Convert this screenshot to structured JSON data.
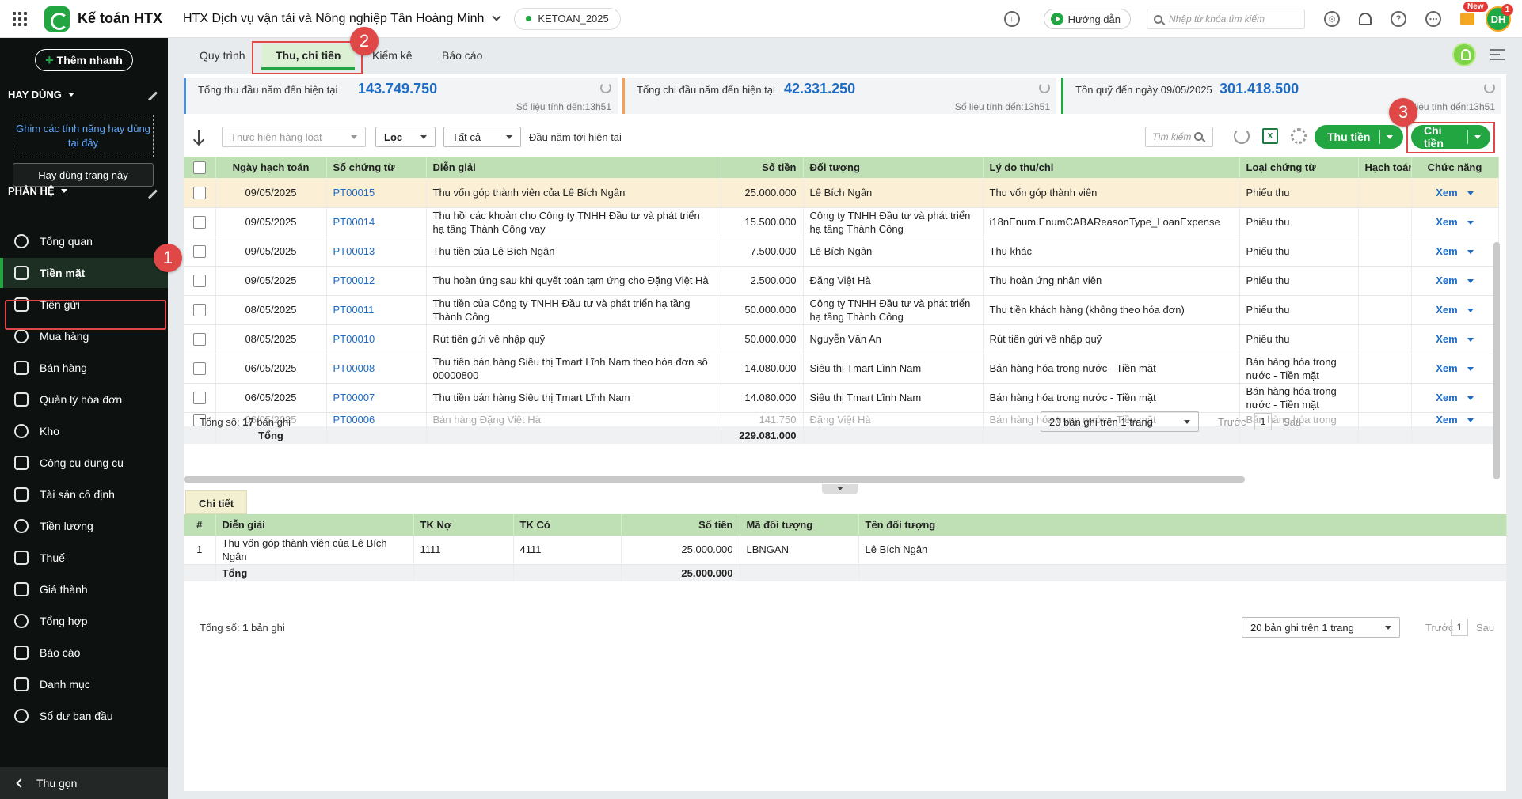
{
  "topbar": {
    "brand": "Kế toán HTX",
    "org": "HTX Dịch vụ vận tải và Nông nghiệp Tân Hoàng Minh",
    "db": "KETOAN_2025",
    "guide": "Hướng dẫn",
    "search_placeholder": "Nhập từ khóa tìm kiếm",
    "new_badge": "New",
    "avatar": "DH",
    "avatar_badge": "1"
  },
  "sidebar": {
    "quick_add": "Thêm nhanh",
    "favorites_title": "HAY DÙNG",
    "pin_hint": "Ghim các tính năng hay dùng tại đây",
    "pin_button": "Hay dùng trang này",
    "modules_title": "PHÂN HỆ",
    "items": [
      {
        "label": "Tổng quan",
        "icon": "dashboard-icon"
      },
      {
        "label": "Tiền mặt",
        "icon": "money-bag-icon"
      },
      {
        "label": "Tiền gửi",
        "icon": "bank-icon"
      },
      {
        "label": "Mua hàng",
        "icon": "shopping-bag-icon"
      },
      {
        "label": "Bán hàng",
        "icon": "cart-icon"
      },
      {
        "label": "Quản lý hóa đơn",
        "icon": "invoice-icon"
      },
      {
        "label": "Kho",
        "icon": "warehouse-icon"
      },
      {
        "label": "Công cụ dụng cụ",
        "icon": "tools-icon"
      },
      {
        "label": "Tài sản cố định",
        "icon": "car-icon"
      },
      {
        "label": "Tiền lương",
        "icon": "payroll-icon"
      },
      {
        "label": "Thuế",
        "icon": "tax-icon"
      },
      {
        "label": "Giá thành",
        "icon": "price-tag-icon"
      },
      {
        "label": "Tổng hợp",
        "icon": "ledger-icon"
      },
      {
        "label": "Báo cáo",
        "icon": "report-icon"
      },
      {
        "label": "Danh mục",
        "icon": "list-icon"
      },
      {
        "label": "Số dư ban đầu",
        "icon": "opening-balance-icon"
      }
    ],
    "collapse": "Thu gọn"
  },
  "steps": [
    "1",
    "2",
    "3"
  ],
  "tabs": [
    "Quy trình",
    "Thu, chi tiền",
    "Kiểm kê",
    "Báo cáo"
  ],
  "stats": [
    {
      "label": "Tổng thu đầu năm đến hiện tại",
      "value": "143.749.750",
      "note": "Số liệu tính đến:13h51",
      "color": "#4a90e2"
    },
    {
      "label": "Tổng chi đầu năm đến hiện tại",
      "value": "42.331.250",
      "note": "Số liệu tính đến:13h51",
      "color": "#f5a05a"
    },
    {
      "label": "Tồn quỹ đến ngày 09/05/2025",
      "value": "301.418.500",
      "note": "Số liệu tính đến:13h51",
      "color": "#21a641"
    }
  ],
  "toolbar": {
    "batch": "Thực hiện hàng loạt",
    "filter": "Lọc",
    "all": "Tất cả",
    "period": "Đầu năm tới hiện tại",
    "search": "Tìm kiếm",
    "excel": "X",
    "receive": "Thu tiền",
    "pay": "Chi tiền"
  },
  "grid": {
    "headers": [
      "Ngày hạch toán",
      "Số chứng từ",
      "Diễn giải",
      "Số tiền",
      "Đối tượng",
      "Lý do thu/chi",
      "Loại chứng từ",
      "Hạch toán",
      "Chức năng"
    ],
    "rows": [
      {
        "date": "09/05/2025",
        "no": "PT00015",
        "desc": "Thu vốn góp thành viên của Lê Bích Ngân",
        "amount": "25.000.000",
        "obj": "Lê Bích Ngân",
        "reason": "Thu vốn góp thành viên",
        "type": "Phiếu thu",
        "action": "Xem"
      },
      {
        "date": "09/05/2025",
        "no": "PT00014",
        "desc": "Thu hồi các khoản cho Công ty TNHH Đầu tư và phát triển hạ tầng Thành Công vay",
        "amount": "15.500.000",
        "obj": "Công ty TNHH Đầu tư và phát triển hạ tầng Thành Công",
        "reason": "i18nEnum.EnumCABAReasonType_LoanExpense",
        "type": "Phiếu thu",
        "action": "Xem"
      },
      {
        "date": "09/05/2025",
        "no": "PT00013",
        "desc": "Thu tiền của Lê Bích Ngân",
        "amount": "7.500.000",
        "obj": "Lê Bích Ngân",
        "reason": "Thu khác",
        "type": "Phiếu thu",
        "action": "Xem"
      },
      {
        "date": "09/05/2025",
        "no": "PT00012",
        "desc": "Thu hoàn ứng sau khi quyết toán tạm ứng cho Đặng Việt Hà",
        "amount": "2.500.000",
        "obj": "Đặng Việt Hà",
        "reason": "Thu hoàn ứng nhân viên",
        "type": "Phiếu thu",
        "action": "Xem"
      },
      {
        "date": "08/05/2025",
        "no": "PT00011",
        "desc": "Thu tiền của Công ty TNHH Đầu tư và phát triển hạ tầng Thành Công",
        "amount": "50.000.000",
        "obj": "Công ty TNHH Đầu tư và phát triển hạ tầng Thành Công",
        "reason": "Thu tiền khách hàng (không theo hóa đơn)",
        "type": "Phiếu thu",
        "action": "Xem"
      },
      {
        "date": "08/05/2025",
        "no": "PT00010",
        "desc": "Rút tiền gửi về nhập quỹ",
        "amount": "50.000.000",
        "obj": "Nguyễn Văn An",
        "reason": "Rút tiền gửi về nhập quỹ",
        "type": "Phiếu thu",
        "action": "Xem"
      },
      {
        "date": "06/05/2025",
        "no": "PT00008",
        "desc": "Thu tiền bán hàng Siêu thị Tmart Lĩnh Nam theo hóa đơn số 00000800",
        "amount": "14.080.000",
        "obj": "Siêu thị Tmart Lĩnh Nam",
        "reason": "Bán hàng hóa trong nước - Tiền mặt",
        "type": "Bán hàng hóa trong nước - Tiền mặt",
        "action": "Xem"
      },
      {
        "date": "06/05/2025",
        "no": "PT00007",
        "desc": "Thu tiền bán hàng Siêu thị Tmart Lĩnh Nam",
        "amount": "14.080.000",
        "obj": "Siêu thị Tmart Lĩnh Nam",
        "reason": "Bán hàng hóa trong nước - Tiền mặt",
        "type": "Bán hàng hóa trong nước - Tiền mặt",
        "action": "Xem"
      }
    ],
    "partial": {
      "date": "06/05/2025",
      "no": "PT00006",
      "desc": "Bán hàng Đặng Việt Hà",
      "amount": "141.750",
      "obj": "Đặng Việt Hà",
      "reason": "Bán hàng hóa trong nước - Tiền mặt",
      "type": "Bán hàng hóa trong",
      "action": "Xem"
    },
    "total_label": "Tổng",
    "total_amount": "229.081.000",
    "count_prefix": "Tổng số:",
    "count": "17",
    "count_suffix": "bản ghi",
    "page_size": "20 bản ghi trên 1 trang",
    "prev": "Trước",
    "page": "1",
    "next": "Sau"
  },
  "detail": {
    "tab": "Chi tiết",
    "headers": [
      "#",
      "Diễn giải",
      "TK Nợ",
      "TK Có",
      "Số tiền",
      "Mã đối tượng",
      "Tên đối tượng"
    ],
    "rows": [
      {
        "idx": "1",
        "desc": "Thu vốn góp thành viên của Lê Bích Ngân",
        "debit": "1111",
        "credit": "4111",
        "amount": "25.000.000",
        "code": "LBNGAN",
        "name": "Lê Bích Ngân"
      }
    ],
    "total_label": "Tổng",
    "total_amount": "25.000.000",
    "count_prefix": "Tổng số:",
    "count": "1",
    "count_suffix": "bản ghi",
    "page_size": "20 bản ghi trên 1 trang",
    "prev": "Trước",
    "page": "1",
    "next": "Sau"
  }
}
